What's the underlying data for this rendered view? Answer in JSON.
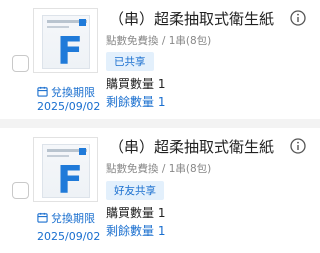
{
  "items": [
    {
      "title": "（串）超柔抽取式衛生紙",
      "subtitle": "點數免費換 / 1串(8包)",
      "share_tag": "已共享",
      "purchase_qty": "購買數量 1",
      "remaining_qty": "剩餘數量 1",
      "expire_label": "兌換期限",
      "expire_date": "2025/09/02",
      "product_icon": "tissue-box-F"
    },
    {
      "title": "（串）超柔抽取式衛生紙",
      "subtitle": "點數免費換 / 1串(8包)",
      "share_tag": "好友共享",
      "purchase_qty": "購買數量 1",
      "remaining_qty": "剩餘數量 1",
      "expire_label": "兌換期限",
      "expire_date": "2025/09/02",
      "product_icon": "tissue-box-F"
    }
  ],
  "colors": {
    "accent": "#1a6fcf",
    "tag_bg": "#e3f0fc",
    "background": "#f3f3f3"
  }
}
